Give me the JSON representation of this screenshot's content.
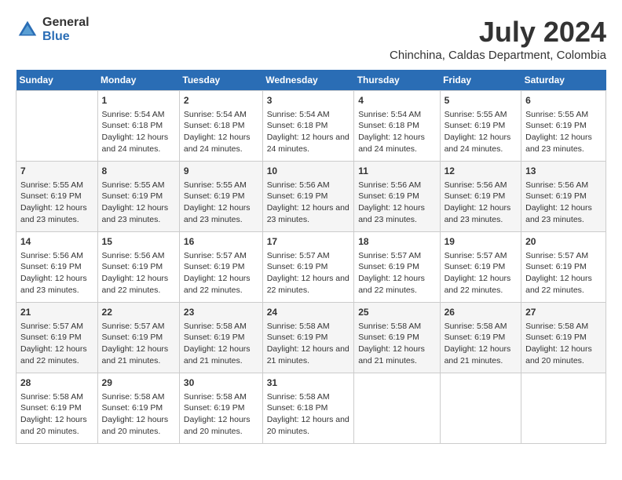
{
  "header": {
    "logo_general": "General",
    "logo_blue": "Blue",
    "month_year": "July 2024",
    "location": "Chinchina, Caldas Department, Colombia"
  },
  "days_of_week": [
    "Sunday",
    "Monday",
    "Tuesday",
    "Wednesday",
    "Thursday",
    "Friday",
    "Saturday"
  ],
  "weeks": [
    [
      {
        "day": "",
        "sunrise": "",
        "sunset": "",
        "daylight": ""
      },
      {
        "day": "1",
        "sunrise": "Sunrise: 5:54 AM",
        "sunset": "Sunset: 6:18 PM",
        "daylight": "Daylight: 12 hours and 24 minutes."
      },
      {
        "day": "2",
        "sunrise": "Sunrise: 5:54 AM",
        "sunset": "Sunset: 6:18 PM",
        "daylight": "Daylight: 12 hours and 24 minutes."
      },
      {
        "day": "3",
        "sunrise": "Sunrise: 5:54 AM",
        "sunset": "Sunset: 6:18 PM",
        "daylight": "Daylight: 12 hours and 24 minutes."
      },
      {
        "day": "4",
        "sunrise": "Sunrise: 5:54 AM",
        "sunset": "Sunset: 6:18 PM",
        "daylight": "Daylight: 12 hours and 24 minutes."
      },
      {
        "day": "5",
        "sunrise": "Sunrise: 5:55 AM",
        "sunset": "Sunset: 6:19 PM",
        "daylight": "Daylight: 12 hours and 24 minutes."
      },
      {
        "day": "6",
        "sunrise": "Sunrise: 5:55 AM",
        "sunset": "Sunset: 6:19 PM",
        "daylight": "Daylight: 12 hours and 23 minutes."
      }
    ],
    [
      {
        "day": "7",
        "sunrise": "Sunrise: 5:55 AM",
        "sunset": "Sunset: 6:19 PM",
        "daylight": "Daylight: 12 hours and 23 minutes."
      },
      {
        "day": "8",
        "sunrise": "Sunrise: 5:55 AM",
        "sunset": "Sunset: 6:19 PM",
        "daylight": "Daylight: 12 hours and 23 minutes."
      },
      {
        "day": "9",
        "sunrise": "Sunrise: 5:55 AM",
        "sunset": "Sunset: 6:19 PM",
        "daylight": "Daylight: 12 hours and 23 minutes."
      },
      {
        "day": "10",
        "sunrise": "Sunrise: 5:56 AM",
        "sunset": "Sunset: 6:19 PM",
        "daylight": "Daylight: 12 hours and 23 minutes."
      },
      {
        "day": "11",
        "sunrise": "Sunrise: 5:56 AM",
        "sunset": "Sunset: 6:19 PM",
        "daylight": "Daylight: 12 hours and 23 minutes."
      },
      {
        "day": "12",
        "sunrise": "Sunrise: 5:56 AM",
        "sunset": "Sunset: 6:19 PM",
        "daylight": "Daylight: 12 hours and 23 minutes."
      },
      {
        "day": "13",
        "sunrise": "Sunrise: 5:56 AM",
        "sunset": "Sunset: 6:19 PM",
        "daylight": "Daylight: 12 hours and 23 minutes."
      }
    ],
    [
      {
        "day": "14",
        "sunrise": "Sunrise: 5:56 AM",
        "sunset": "Sunset: 6:19 PM",
        "daylight": "Daylight: 12 hours and 23 minutes."
      },
      {
        "day": "15",
        "sunrise": "Sunrise: 5:56 AM",
        "sunset": "Sunset: 6:19 PM",
        "daylight": "Daylight: 12 hours and 22 minutes."
      },
      {
        "day": "16",
        "sunrise": "Sunrise: 5:57 AM",
        "sunset": "Sunset: 6:19 PM",
        "daylight": "Daylight: 12 hours and 22 minutes."
      },
      {
        "day": "17",
        "sunrise": "Sunrise: 5:57 AM",
        "sunset": "Sunset: 6:19 PM",
        "daylight": "Daylight: 12 hours and 22 minutes."
      },
      {
        "day": "18",
        "sunrise": "Sunrise: 5:57 AM",
        "sunset": "Sunset: 6:19 PM",
        "daylight": "Daylight: 12 hours and 22 minutes."
      },
      {
        "day": "19",
        "sunrise": "Sunrise: 5:57 AM",
        "sunset": "Sunset: 6:19 PM",
        "daylight": "Daylight: 12 hours and 22 minutes."
      },
      {
        "day": "20",
        "sunrise": "Sunrise: 5:57 AM",
        "sunset": "Sunset: 6:19 PM",
        "daylight": "Daylight: 12 hours and 22 minutes."
      }
    ],
    [
      {
        "day": "21",
        "sunrise": "Sunrise: 5:57 AM",
        "sunset": "Sunset: 6:19 PM",
        "daylight": "Daylight: 12 hours and 22 minutes."
      },
      {
        "day": "22",
        "sunrise": "Sunrise: 5:57 AM",
        "sunset": "Sunset: 6:19 PM",
        "daylight": "Daylight: 12 hours and 21 minutes."
      },
      {
        "day": "23",
        "sunrise": "Sunrise: 5:58 AM",
        "sunset": "Sunset: 6:19 PM",
        "daylight": "Daylight: 12 hours and 21 minutes."
      },
      {
        "day": "24",
        "sunrise": "Sunrise: 5:58 AM",
        "sunset": "Sunset: 6:19 PM",
        "daylight": "Daylight: 12 hours and 21 minutes."
      },
      {
        "day": "25",
        "sunrise": "Sunrise: 5:58 AM",
        "sunset": "Sunset: 6:19 PM",
        "daylight": "Daylight: 12 hours and 21 minutes."
      },
      {
        "day": "26",
        "sunrise": "Sunrise: 5:58 AM",
        "sunset": "Sunset: 6:19 PM",
        "daylight": "Daylight: 12 hours and 21 minutes."
      },
      {
        "day": "27",
        "sunrise": "Sunrise: 5:58 AM",
        "sunset": "Sunset: 6:19 PM",
        "daylight": "Daylight: 12 hours and 20 minutes."
      }
    ],
    [
      {
        "day": "28",
        "sunrise": "Sunrise: 5:58 AM",
        "sunset": "Sunset: 6:19 PM",
        "daylight": "Daylight: 12 hours and 20 minutes."
      },
      {
        "day": "29",
        "sunrise": "Sunrise: 5:58 AM",
        "sunset": "Sunset: 6:19 PM",
        "daylight": "Daylight: 12 hours and 20 minutes."
      },
      {
        "day": "30",
        "sunrise": "Sunrise: 5:58 AM",
        "sunset": "Sunset: 6:19 PM",
        "daylight": "Daylight: 12 hours and 20 minutes."
      },
      {
        "day": "31",
        "sunrise": "Sunrise: 5:58 AM",
        "sunset": "Sunset: 6:18 PM",
        "daylight": "Daylight: 12 hours and 20 minutes."
      },
      {
        "day": "",
        "sunrise": "",
        "sunset": "",
        "daylight": ""
      },
      {
        "day": "",
        "sunrise": "",
        "sunset": "",
        "daylight": ""
      },
      {
        "day": "",
        "sunrise": "",
        "sunset": "",
        "daylight": ""
      }
    ]
  ]
}
